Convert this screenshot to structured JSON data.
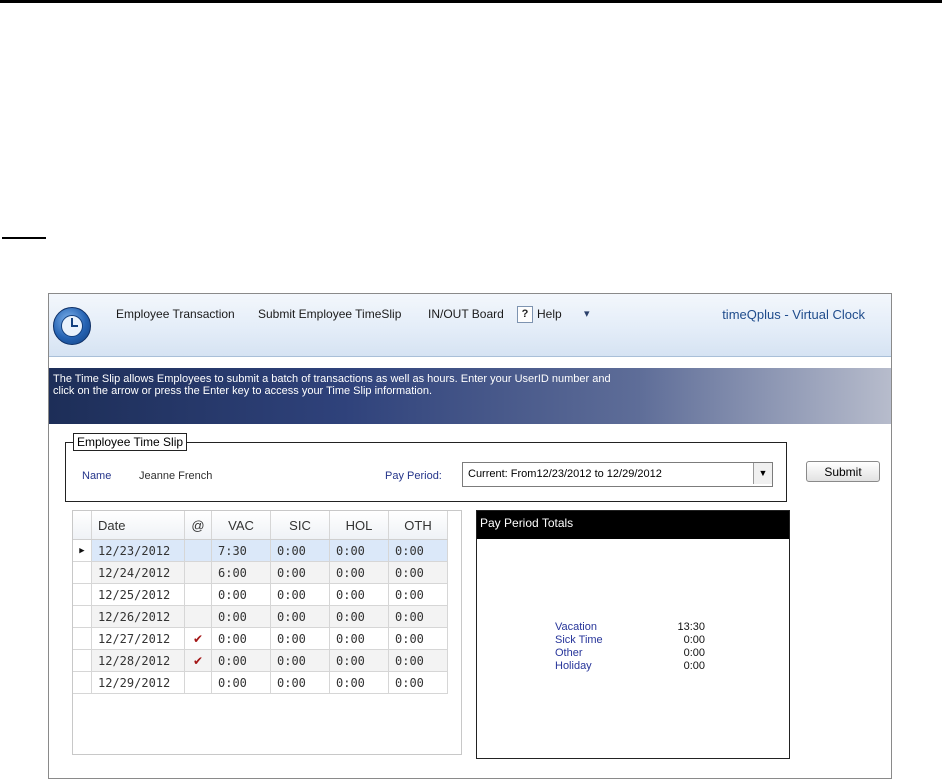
{
  "ribbon": {
    "menu": [
      "Employee Transaction",
      "Submit Employee TimeSlip",
      "IN/OUT Board",
      "Help"
    ],
    "help_icon_glyph": "?",
    "quick_access_glyph": "▾",
    "app_title": "timeQplus - Virtual Clock"
  },
  "banner": {
    "text": "The Time Slip allows Employees to submit a batch of transactions as well as hours.  Enter your UserID number and click on the arrow or press the Enter key to access your Time Slip information."
  },
  "timeslip": {
    "legend": "Employee Time Slip",
    "name_label": "Name",
    "name_value": "Jeanne French",
    "pay_period_label": "Pay Period:",
    "pay_period_value": "Current:  From12/23/2012 to 12/29/2012",
    "submit_label": "Submit"
  },
  "grid": {
    "columns": [
      "Date",
      "@",
      "VAC",
      "SIC",
      "HOL",
      "OTH"
    ],
    "row_indicator_glyph": "▶",
    "check_glyph": "✔",
    "rows": [
      {
        "date": "12/23/2012",
        "at": "",
        "vac": "7:30",
        "sic": "0:00",
        "hol": "0:00",
        "oth": "0:00"
      },
      {
        "date": "12/24/2012",
        "at": "",
        "vac": "6:00",
        "sic": "0:00",
        "hol": "0:00",
        "oth": "0:00"
      },
      {
        "date": "12/25/2012",
        "at": "",
        "vac": "0:00",
        "sic": "0:00",
        "hol": "0:00",
        "oth": "0:00"
      },
      {
        "date": "12/26/2012",
        "at": "",
        "vac": "0:00",
        "sic": "0:00",
        "hol": "0:00",
        "oth": "0:00"
      },
      {
        "date": "12/27/2012",
        "at": "✔",
        "vac": "0:00",
        "sic": "0:00",
        "hol": "0:00",
        "oth": "0:00"
      },
      {
        "date": "12/28/2012",
        "at": "✔",
        "vac": "0:00",
        "sic": "0:00",
        "hol": "0:00",
        "oth": "0:00"
      },
      {
        "date": "12/29/2012",
        "at": "",
        "vac": "0:00",
        "sic": "0:00",
        "hol": "0:00",
        "oth": "0:00"
      }
    ]
  },
  "totals": {
    "title": "Pay Period Totals",
    "items": [
      {
        "label": "Vacation",
        "value": "13:30"
      },
      {
        "label": "Sick Time",
        "value": "0:00"
      },
      {
        "label": "Other",
        "value": "0:00"
      },
      {
        "label": "Holiday",
        "value": "0:00"
      }
    ]
  },
  "colors": {
    "banner_start": "#1d2e58",
    "label_blue": "#24348a",
    "app_title": "#1f4c8c",
    "check_red": "#a31515",
    "selected_row": "#dbe8f9"
  }
}
